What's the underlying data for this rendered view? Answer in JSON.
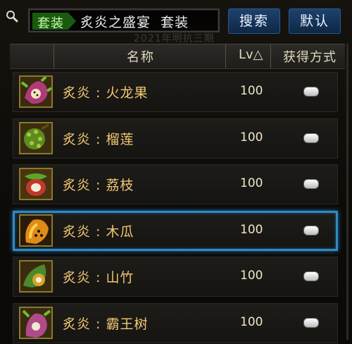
{
  "search": {
    "tag": "套装",
    "query": "炙炎之盛宴  套装",
    "ghost_text": "2021年明抗三期",
    "search_button": "搜索",
    "default_button": "默认"
  },
  "table": {
    "columns": {
      "name": "名称",
      "level": "Lv△",
      "source": "获得方式"
    },
    "rows": [
      {
        "name": "炙炎 : 火龙果",
        "level": "100",
        "icon": "dragonfruit-icon",
        "color": "#b03a78"
      },
      {
        "name": "炙炎 : 榴莲",
        "level": "100",
        "icon": "durian-icon",
        "color": "#5f8a20"
      },
      {
        "name": "炙炎 : 荔枝",
        "level": "100",
        "icon": "lychee-icon",
        "color": "#c0392b"
      },
      {
        "name": "炙炎 : 木瓜",
        "level": "100",
        "icon": "papaya-icon",
        "color": "#e08a18",
        "selected": true
      },
      {
        "name": "炙炎 : 山竹",
        "level": "100",
        "icon": "mangosteen-icon",
        "color": "#4a8a2a"
      },
      {
        "name": "炙炎 : 霸王树",
        "level": "100",
        "icon": "cactus-icon",
        "color": "#b04a88"
      }
    ]
  },
  "colors": {
    "accent_blue": "#2f8ac4",
    "item_name": "#f2c873",
    "header_text": "#e2d9bf"
  }
}
